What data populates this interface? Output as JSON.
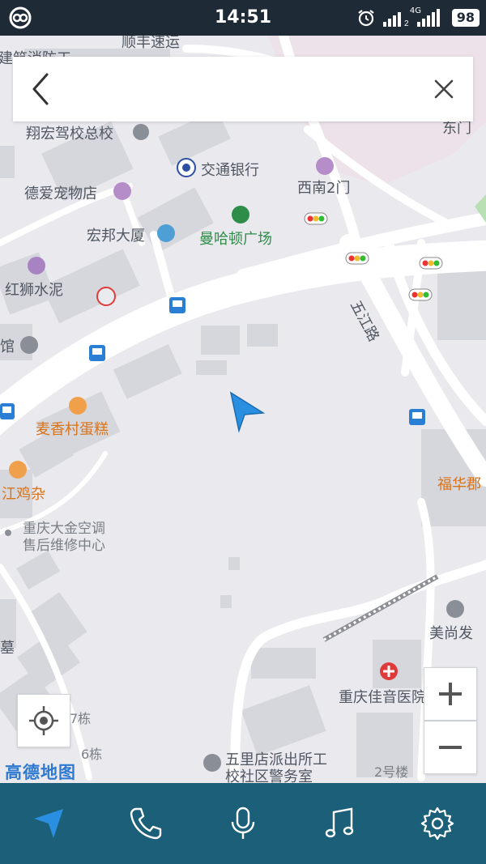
{
  "status_bar": {
    "time": "14:51",
    "battery": "98",
    "network": "4G",
    "sim_number": "2"
  },
  "search": {
    "value": "",
    "placeholder": ""
  },
  "map": {
    "pois": {
      "shunfeng": "顺丰速运",
      "jianzhu": "建筑消防工",
      "xianghong": "翔宏驾校总校",
      "jiaotong": "交通银行",
      "xinan": "西南2门",
      "dongmen": "东门",
      "deai": "德爱宠物店",
      "hongbang": "宏邦大厦",
      "manhadun": "曼哈顿广场",
      "hongshi": "红狮水泥",
      "guan": "馆",
      "wujianglu": "五江路",
      "maixiang": "麦香村蛋糕",
      "jiangjiza": "江鸡杂",
      "fuhuajun": "福华郡",
      "dajin_line1": "重庆大金空调",
      "dajin_line2": "售后维修中心",
      "meishang": "美尚发",
      "mu": "墓",
      "jiayin": "重庆佳音医院",
      "bldg7": "7栋",
      "bldg6": "6栋",
      "wulidian_line1": "五里店派出所工",
      "wulidian_line2": "校社区警务室",
      "bldg2": "2号楼"
    },
    "logo": "高德地图"
  },
  "controls": {
    "locate_icon": "locate-icon",
    "zoom_in_icon": "plus-icon",
    "zoom_out_icon": "minus-icon"
  },
  "bottom_nav": {
    "items": [
      "navigation-icon",
      "phone-icon",
      "microphone-icon",
      "music-icon",
      "settings-icon"
    ]
  },
  "colors": {
    "status_bar": "#1f2a37",
    "bottom_bar": "#1c5f79",
    "nav_arrow": "#2a8fe0",
    "road": "#ffffff",
    "block": "#d6d7dc",
    "green_poi": "#2f8d4a",
    "orange_poi": "#d9731a"
  }
}
